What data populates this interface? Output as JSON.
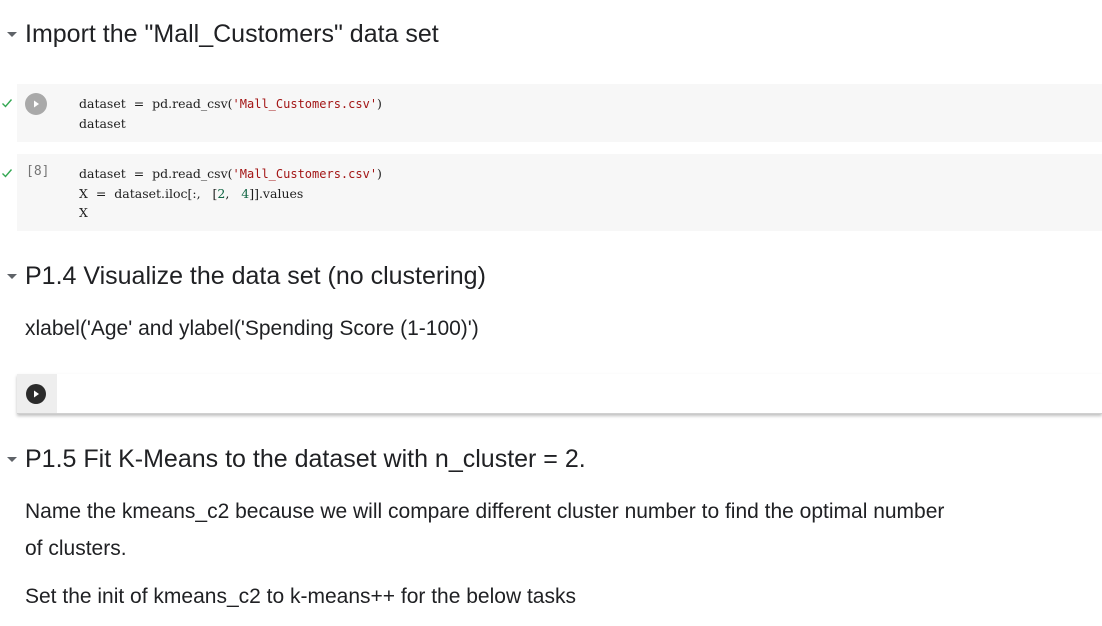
{
  "sections": {
    "import": {
      "title": "Import the \"Mall_Customers\" data set"
    },
    "p14": {
      "title": "P1.4 Visualize the data set (no clustering)",
      "text": "xlabel('Age' and ylabel('Spending Score (1-100)')"
    },
    "p15": {
      "title": "P1.5 Fit K-Means to the dataset with n_cluster = 2.",
      "para1_line1": "Name the kmeans_c2 because we will compare different cluster number to find the optimal number",
      "para1_line2": "of clusters.",
      "para2": "Set the init of kmeans_c2 to k-means++ for the below tasks"
    }
  },
  "cells": {
    "cell1": {
      "line1_pre": "dataset  =  pd.read_csv(",
      "line1_str": "'Mall_Customers.csv'",
      "line1_post": ")",
      "line2": "dataset"
    },
    "cell2": {
      "exec_count": "[8]",
      "line1_pre": "dataset  =  pd.read_csv(",
      "line1_str": "'Mall_Customers.csv'",
      "line1_post": ")",
      "line2_pre": "X  =  dataset.iloc[:,   [",
      "line2_n1": "2",
      "line2_mid": ",   ",
      "line2_n2": "4",
      "line2_post": "]].values",
      "line3": "X"
    },
    "cell3": {
      "content": ""
    }
  },
  "icons": {
    "collapse": "chevron-down-icon",
    "run": "play-icon",
    "status": "checkmark-icon"
  },
  "colors": {
    "check": "#34a853",
    "string": "#a31515",
    "number": "#116644",
    "cell_bg": "#f7f7f7"
  }
}
